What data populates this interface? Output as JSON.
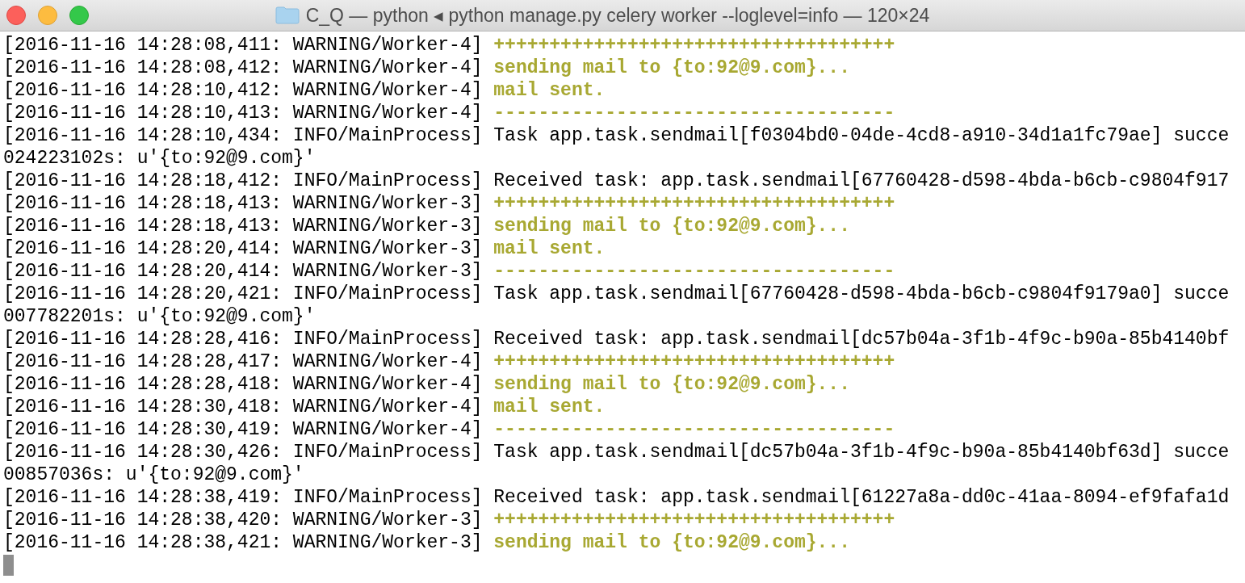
{
  "window": {
    "title": "C_Q — python ◂ python manage.py celery worker --loglevel=info — 120×24"
  },
  "lines": [
    {
      "kind": "log",
      "header": "[2016-11-16 14:28:08,411: WARNING/Worker-4]",
      "message": "++++++++++++++++++++++++++++++++++++",
      "highlight": true
    },
    {
      "kind": "log",
      "header": "[2016-11-16 14:28:08,412: WARNING/Worker-4]",
      "message": "sending mail to {to:92@9.com}...",
      "highlight": true
    },
    {
      "kind": "log",
      "header": "[2016-11-16 14:28:10,412: WARNING/Worker-4]",
      "message": "mail sent.",
      "highlight": true
    },
    {
      "kind": "log",
      "header": "[2016-11-16 14:28:10,413: WARNING/Worker-4]",
      "message": "------------------------------------",
      "highlight": true
    },
    {
      "kind": "log",
      "header": "[2016-11-16 14:28:10,434: INFO/MainProcess]",
      "message": "Task app.task.sendmail[f0304bd0-04de-4cd8-a910-34d1a1fc79ae] succe",
      "highlight": false
    },
    {
      "kind": "continuation",
      "message": "024223102s: u'{to:92@9.com}'",
      "highlight": false
    },
    {
      "kind": "log",
      "header": "[2016-11-16 14:28:18,412: INFO/MainProcess]",
      "message": "Received task: app.task.sendmail[67760428-d598-4bda-b6cb-c9804f917",
      "highlight": false
    },
    {
      "kind": "log",
      "header": "[2016-11-16 14:28:18,413: WARNING/Worker-3]",
      "message": "++++++++++++++++++++++++++++++++++++",
      "highlight": true
    },
    {
      "kind": "log",
      "header": "[2016-11-16 14:28:18,413: WARNING/Worker-3]",
      "message": "sending mail to {to:92@9.com}...",
      "highlight": true
    },
    {
      "kind": "log",
      "header": "[2016-11-16 14:28:20,414: WARNING/Worker-3]",
      "message": "mail sent.",
      "highlight": true
    },
    {
      "kind": "log",
      "header": "[2016-11-16 14:28:20,414: WARNING/Worker-3]",
      "message": "------------------------------------",
      "highlight": true
    },
    {
      "kind": "log",
      "header": "[2016-11-16 14:28:20,421: INFO/MainProcess]",
      "message": "Task app.task.sendmail[67760428-d598-4bda-b6cb-c9804f9179a0] succe",
      "highlight": false
    },
    {
      "kind": "continuation",
      "message": "007782201s: u'{to:92@9.com}'",
      "highlight": false
    },
    {
      "kind": "log",
      "header": "[2016-11-16 14:28:28,416: INFO/MainProcess]",
      "message": "Received task: app.task.sendmail[dc57b04a-3f1b-4f9c-b90a-85b4140bf",
      "highlight": false
    },
    {
      "kind": "log",
      "header": "[2016-11-16 14:28:28,417: WARNING/Worker-4]",
      "message": "++++++++++++++++++++++++++++++++++++",
      "highlight": true
    },
    {
      "kind": "log",
      "header": "[2016-11-16 14:28:28,418: WARNING/Worker-4]",
      "message": "sending mail to {to:92@9.com}...",
      "highlight": true
    },
    {
      "kind": "log",
      "header": "[2016-11-16 14:28:30,418: WARNING/Worker-4]",
      "message": "mail sent.",
      "highlight": true
    },
    {
      "kind": "log",
      "header": "[2016-11-16 14:28:30,419: WARNING/Worker-4]",
      "message": "------------------------------------",
      "highlight": true
    },
    {
      "kind": "log",
      "header": "[2016-11-16 14:28:30,426: INFO/MainProcess]",
      "message": "Task app.task.sendmail[dc57b04a-3f1b-4f9c-b90a-85b4140bf63d] succe",
      "highlight": false
    },
    {
      "kind": "continuation",
      "message": "00857036s: u'{to:92@9.com}'",
      "highlight": false
    },
    {
      "kind": "log",
      "header": "[2016-11-16 14:28:38,419: INFO/MainProcess]",
      "message": "Received task: app.task.sendmail[61227a8a-dd0c-41aa-8094-ef9fafa1d",
      "highlight": false
    },
    {
      "kind": "log",
      "header": "[2016-11-16 14:28:38,420: WARNING/Worker-3]",
      "message": "++++++++++++++++++++++++++++++++++++",
      "highlight": true
    },
    {
      "kind": "log",
      "header": "[2016-11-16 14:28:38,421: WARNING/Worker-3]",
      "message": "sending mail to {to:92@9.com}...",
      "highlight": true
    }
  ]
}
